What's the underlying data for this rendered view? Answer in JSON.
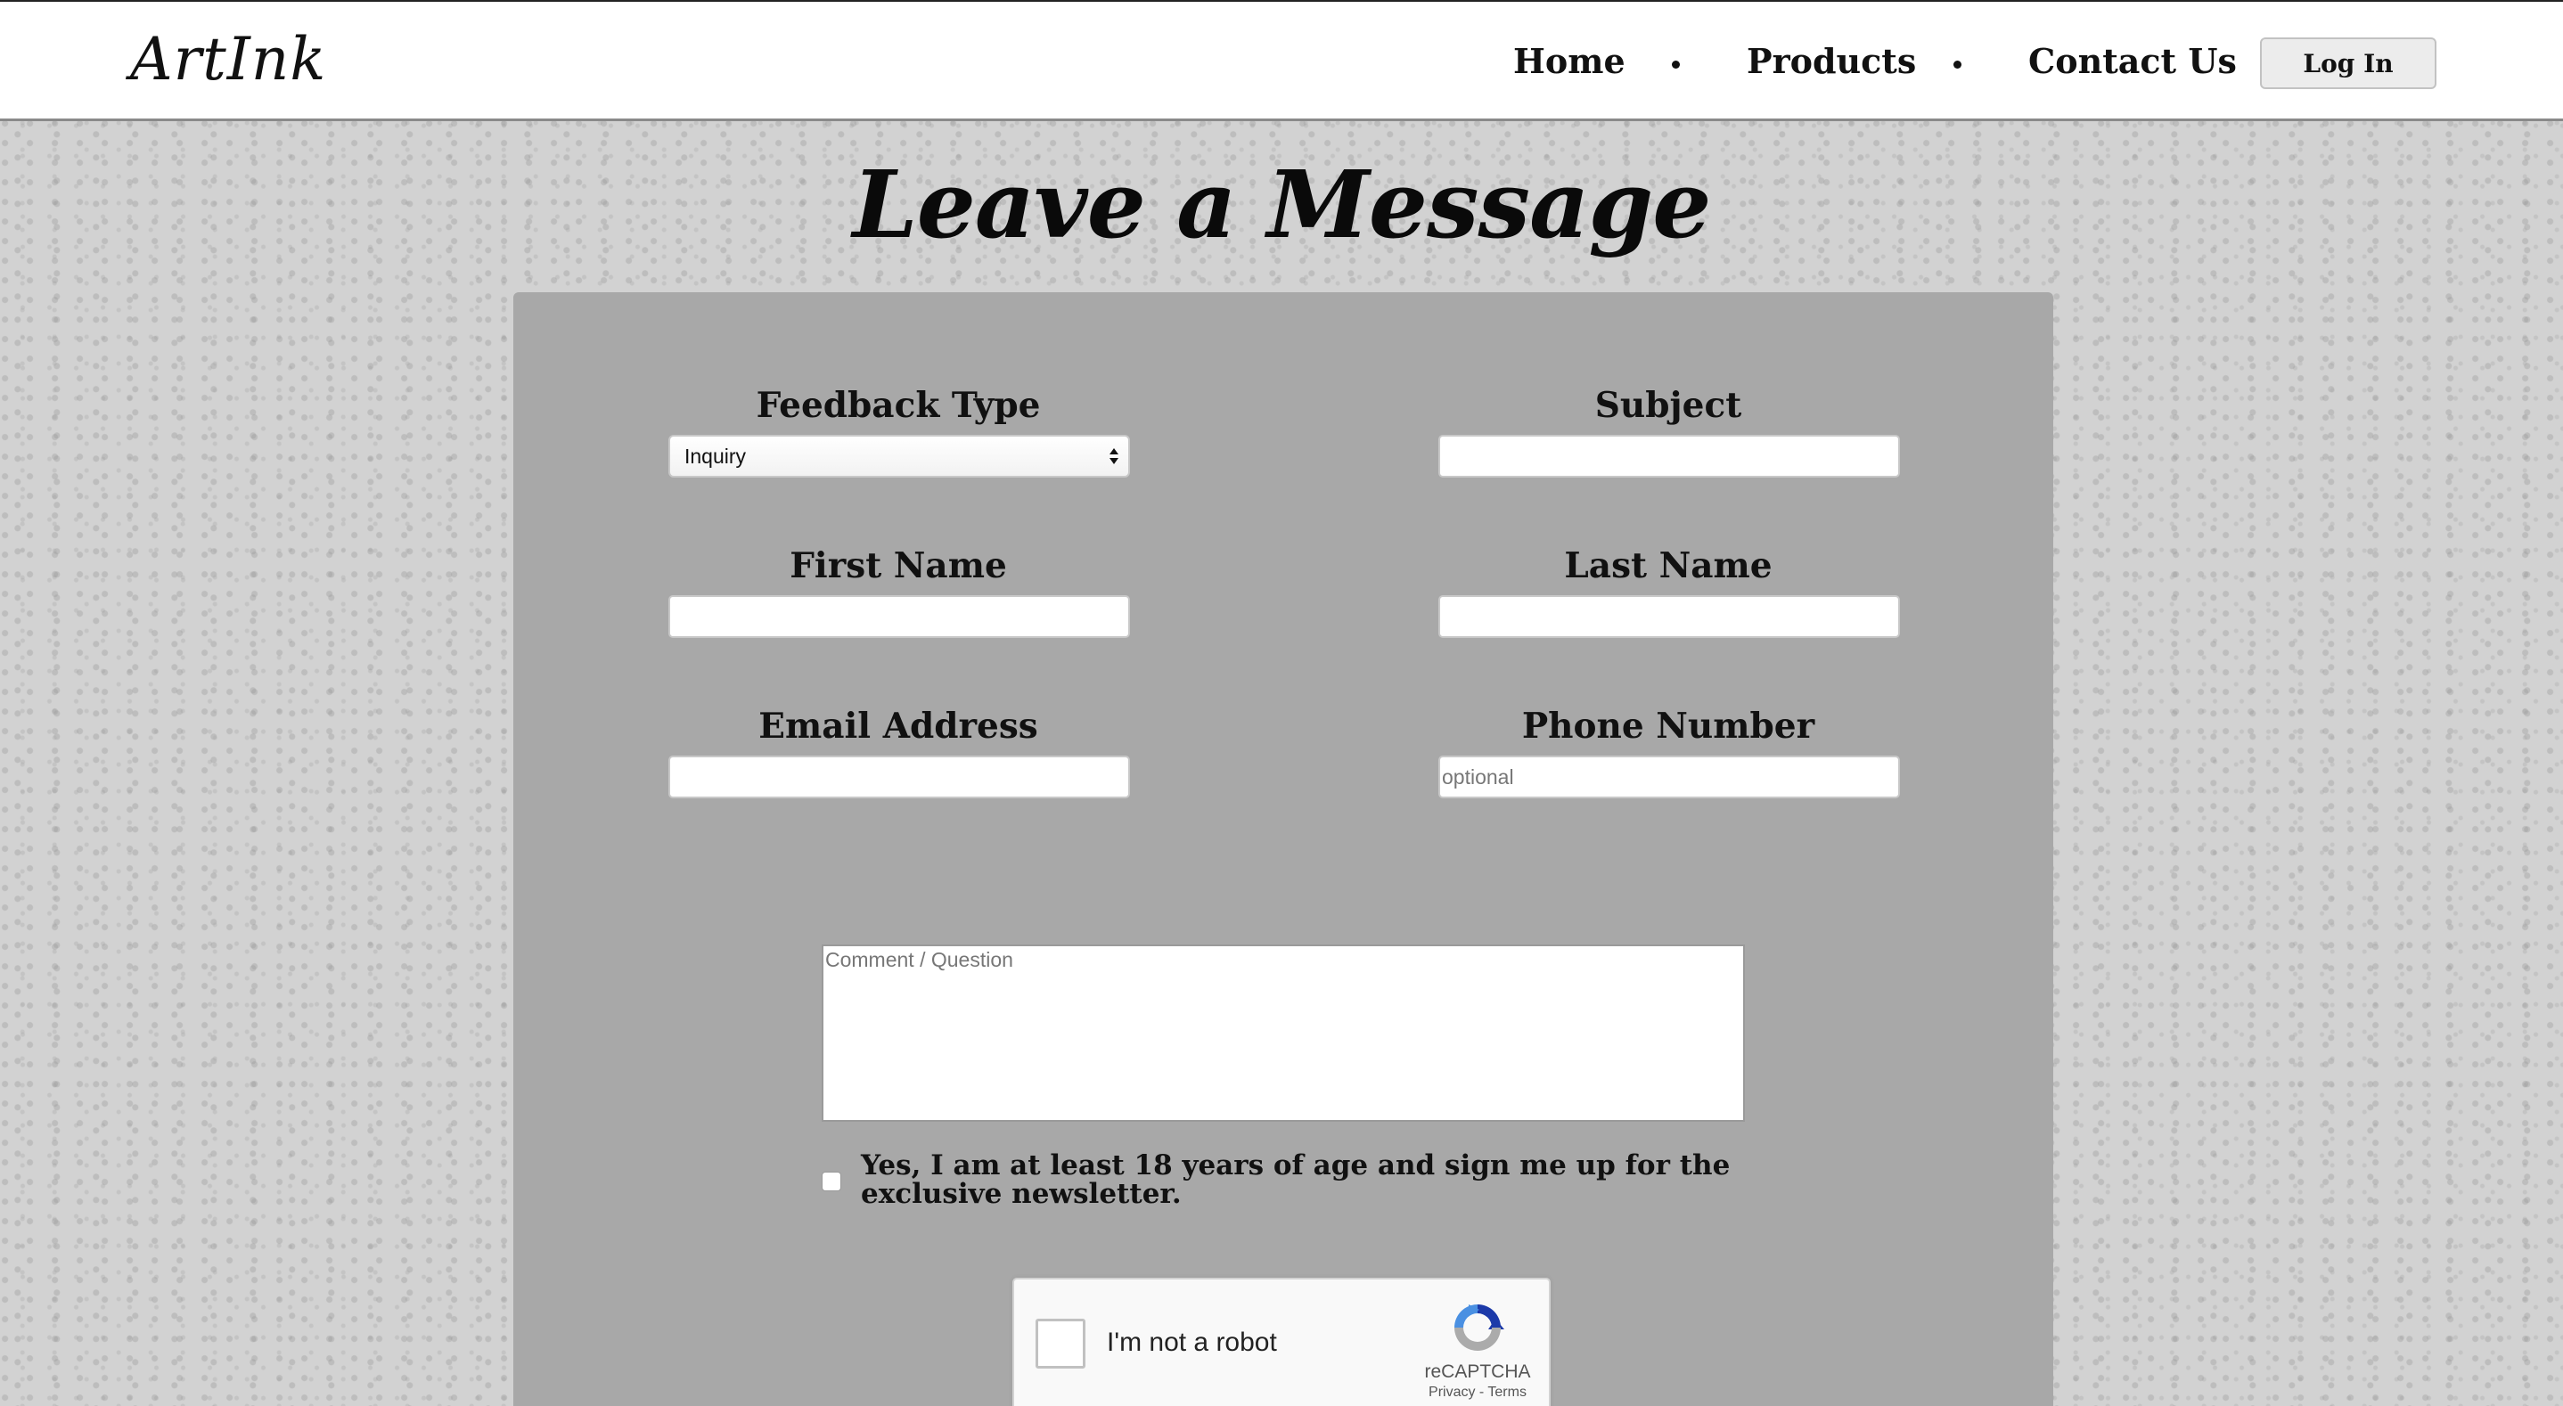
{
  "header": {
    "logo": "ArtInk",
    "nav": [
      {
        "label": "Home"
      },
      {
        "label": "Products"
      },
      {
        "label": "Contact Us"
      }
    ],
    "login_label": "Log In"
  },
  "page": {
    "title": "Leave a Message"
  },
  "form": {
    "feedback_type": {
      "label": "Feedback Type",
      "selected": "Inquiry"
    },
    "subject": {
      "label": "Subject",
      "value": ""
    },
    "first_name": {
      "label": "First Name",
      "value": ""
    },
    "last_name": {
      "label": "Last Name",
      "value": ""
    },
    "email": {
      "label": "Email Address",
      "value": ""
    },
    "phone": {
      "label": "Phone Number",
      "placeholder": "optional"
    },
    "comment": {
      "placeholder": "Comment / Question"
    },
    "newsletter": {
      "label": "Yes, I am at least 18 years of age and sign me up for the exclusive newsletter.",
      "checked": false
    }
  },
  "recaptcha": {
    "text": "I'm not a robot",
    "brand": "reCAPTCHA",
    "privacy": "Privacy",
    "separator": " - ",
    "terms": "Terms"
  },
  "colors": {
    "panel": "#a8a8a8",
    "header_bg": "#ffffff",
    "page_bg": "#d2d2d2",
    "recaptcha_blue": "#1c3aa9",
    "recaptcha_lightblue": "#4a90e2",
    "recaptcha_gray": "#ababab"
  },
  "icons": {
    "select_arrows": "updown-arrows-icon",
    "recaptcha_logo": "recaptcha-logo-icon"
  }
}
